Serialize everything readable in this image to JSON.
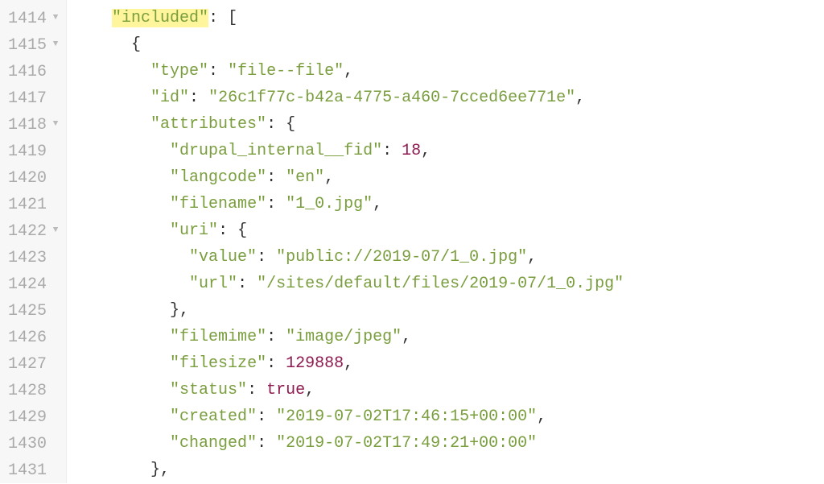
{
  "lines": [
    {
      "num": "1414",
      "fold": true
    },
    {
      "num": "1415",
      "fold": true
    },
    {
      "num": "1416",
      "fold": false
    },
    {
      "num": "1417",
      "fold": false
    },
    {
      "num": "1418",
      "fold": true
    },
    {
      "num": "1419",
      "fold": false
    },
    {
      "num": "1420",
      "fold": false
    },
    {
      "num": "1421",
      "fold": false
    },
    {
      "num": "1422",
      "fold": true
    },
    {
      "num": "1423",
      "fold": false
    },
    {
      "num": "1424",
      "fold": false
    },
    {
      "num": "1425",
      "fold": false
    },
    {
      "num": "1426",
      "fold": false
    },
    {
      "num": "1427",
      "fold": false
    },
    {
      "num": "1428",
      "fold": false
    },
    {
      "num": "1429",
      "fold": false
    },
    {
      "num": "1430",
      "fold": false
    },
    {
      "num": "1431",
      "fold": false
    }
  ],
  "content": {
    "key_included": "\"included\"",
    "open_bracket": ": [",
    "open_brace1": "{",
    "key_type": "\"type\"",
    "val_type": "\"file--file\"",
    "key_id": "\"id\"",
    "val_id": "\"26c1f77c-b42a-4775-a460-7cced6ee771e\"",
    "key_attributes": "\"attributes\"",
    "open_brace2": ": {",
    "key_fid": "\"drupal_internal__fid\"",
    "val_fid": "18",
    "key_langcode": "\"langcode\"",
    "val_langcode": "\"en\"",
    "key_filename": "\"filename\"",
    "val_filename": "\"1_0.jpg\"",
    "key_uri": "\"uri\"",
    "open_brace3": ": {",
    "key_value": "\"value\"",
    "val_value": "\"public://2019-07/1_0.jpg\"",
    "key_url": "\"url\"",
    "val_url": "\"/sites/default/files/2019-07/1_0.jpg\"",
    "close_brace3": "},",
    "key_filemime": "\"filemime\"",
    "val_filemime": "\"image/jpeg\"",
    "key_filesize": "\"filesize\"",
    "val_filesize": "129888",
    "key_status": "\"status\"",
    "val_status": "true",
    "key_created": "\"created\"",
    "val_created": "\"2019-07-02T17:46:15+00:00\"",
    "key_changed": "\"changed\"",
    "val_changed": "\"2019-07-02T17:49:21+00:00\"",
    "close_brace2": "},",
    "colon": ": ",
    "comma": ",",
    "fold_glyph": "▼"
  },
  "indent": {
    "i1": "    ",
    "i2": "      ",
    "i3": "        ",
    "i4": "          ",
    "i5": "            "
  }
}
